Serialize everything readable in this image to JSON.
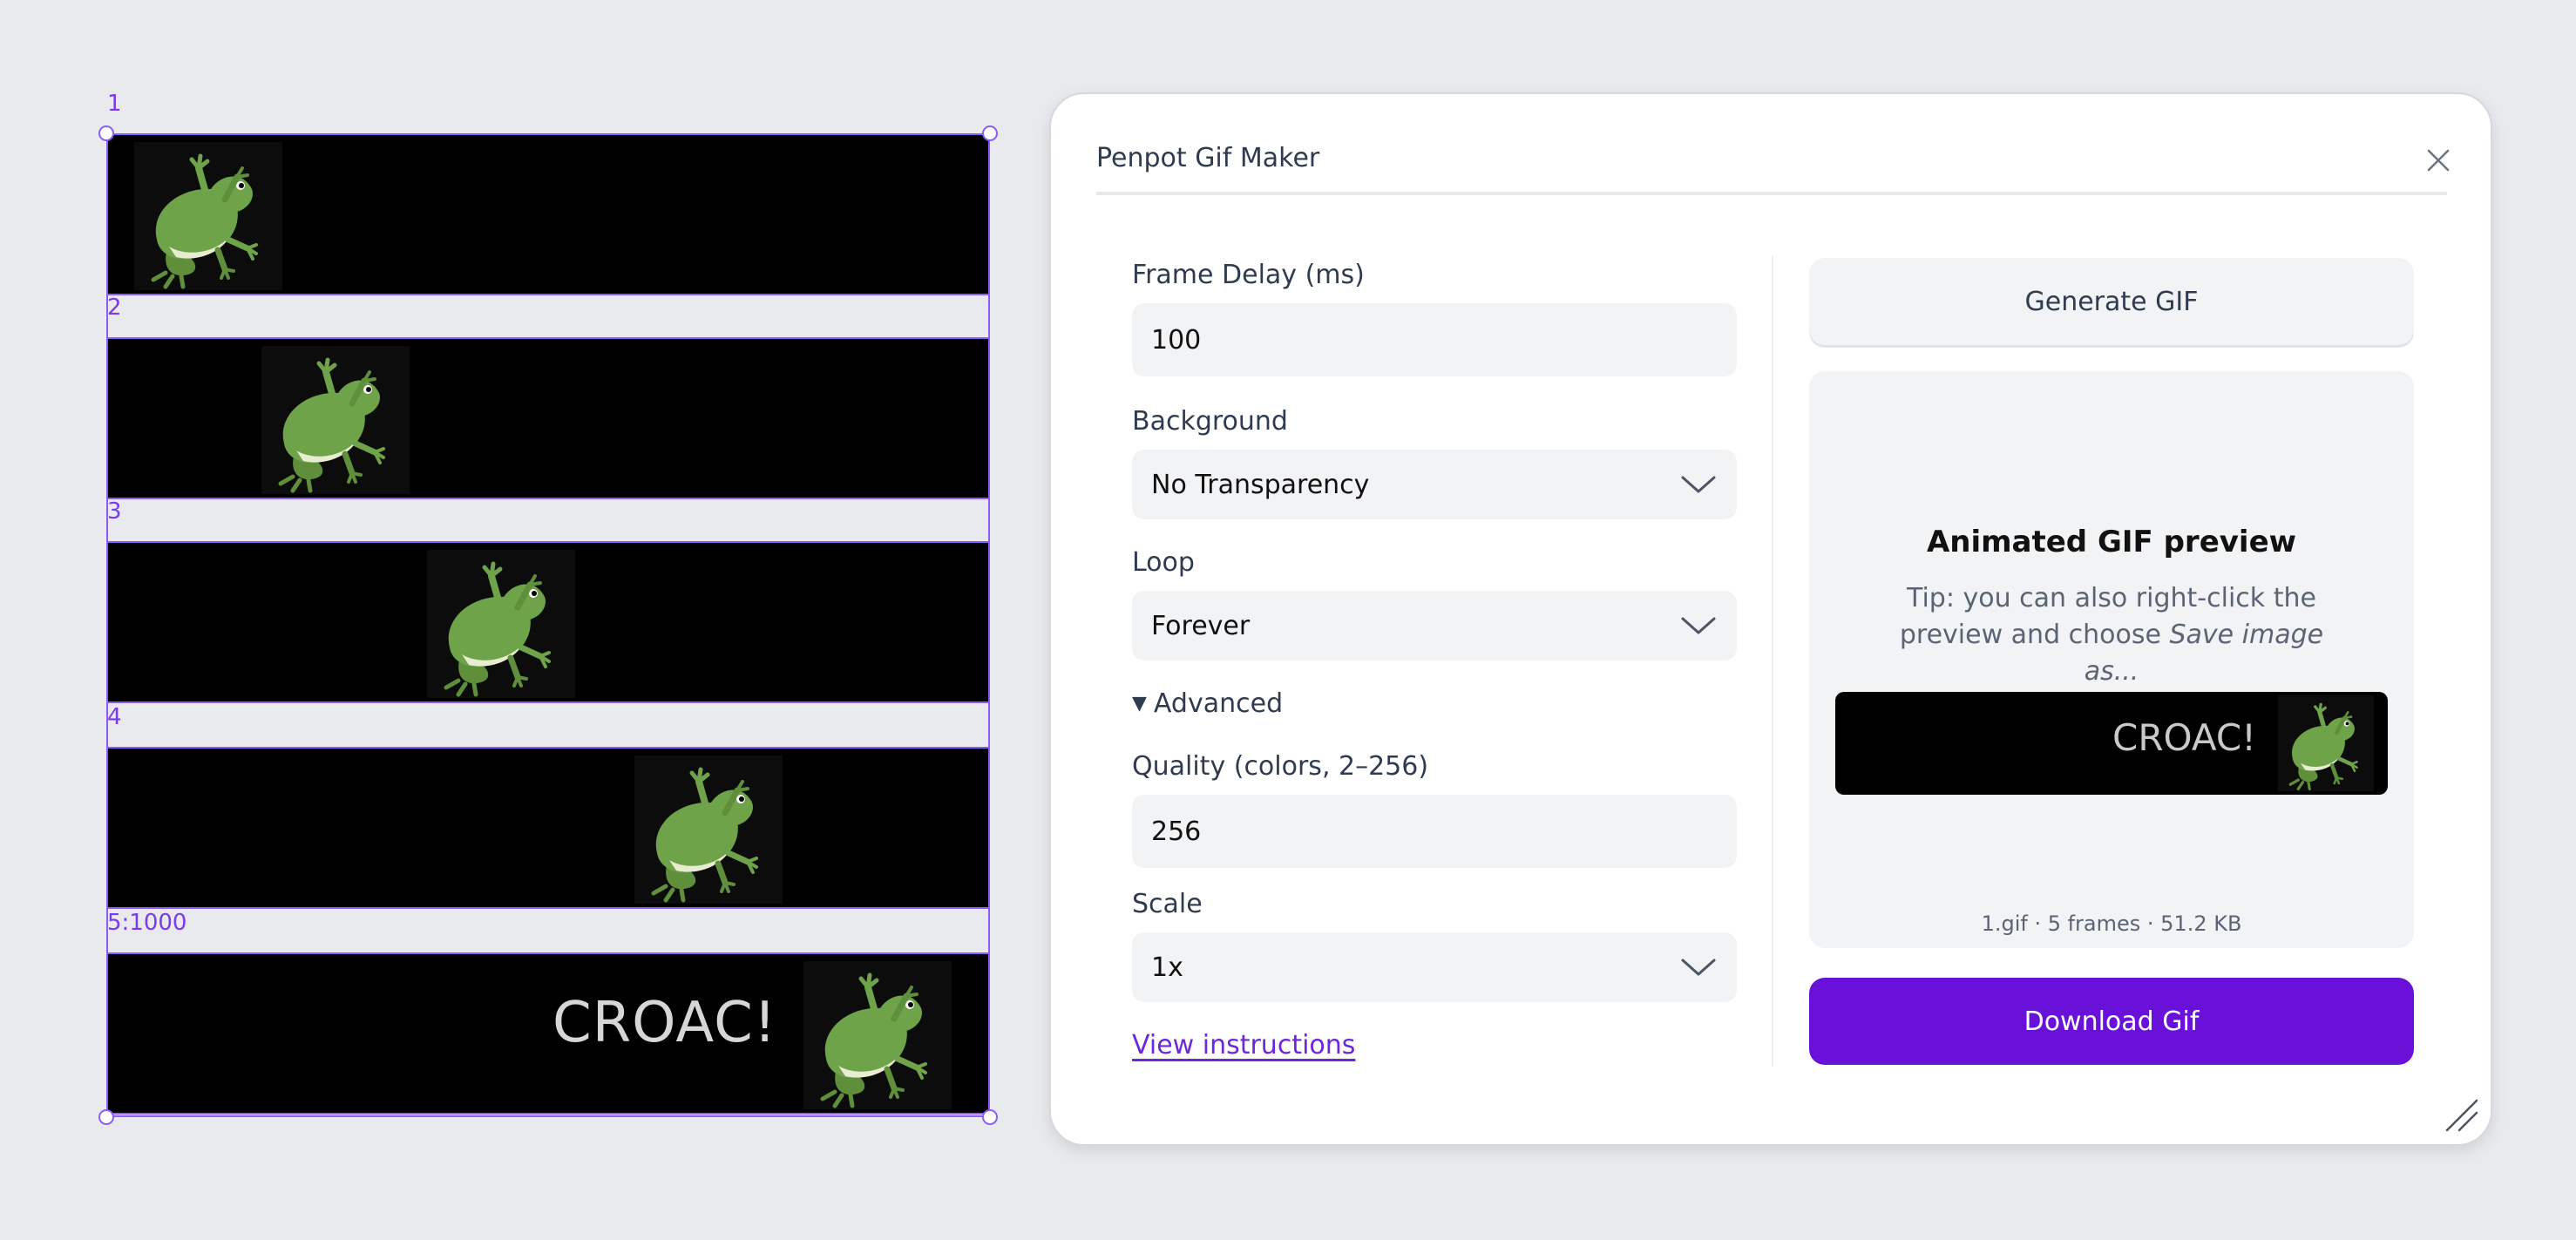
{
  "canvas": {
    "frames": [
      {
        "label": "1"
      },
      {
        "label": "2"
      },
      {
        "label": "3"
      },
      {
        "label": "4"
      },
      {
        "label": "5:1000",
        "text": "CROAC!"
      }
    ]
  },
  "panel": {
    "title": "Penpot Gif Maker",
    "frame_delay": {
      "label": "Frame Delay (ms)",
      "value": "100"
    },
    "background": {
      "label": "Background",
      "value": "No Transparency"
    },
    "loop": {
      "label": "Loop",
      "value": "Forever"
    },
    "advanced": {
      "label": "Advanced"
    },
    "quality": {
      "label": "Quality (colors, 2–256)",
      "value": "256"
    },
    "scale": {
      "label": "Scale",
      "value": "1x"
    },
    "view_instructions": "View instructions",
    "generate_button": "Generate GIF",
    "preview": {
      "heading": "Animated GIF preview",
      "tip_prefix": "Tip: you can also right-click the preview and choose ",
      "tip_italic": "Save image as...",
      "image_text": "CROAC!",
      "meta": "1.gif · 5 frames · 51.2 KB"
    },
    "download_button": "Download Gif"
  },
  "colors": {
    "accent": "#6911d8",
    "selection": "#8b5cf6",
    "canvas_bg": "#e8eaed"
  },
  "icons": [
    "frog-image",
    "close-icon",
    "chevron-down-icon",
    "triangle-down-icon",
    "resize-grip-icon"
  ]
}
